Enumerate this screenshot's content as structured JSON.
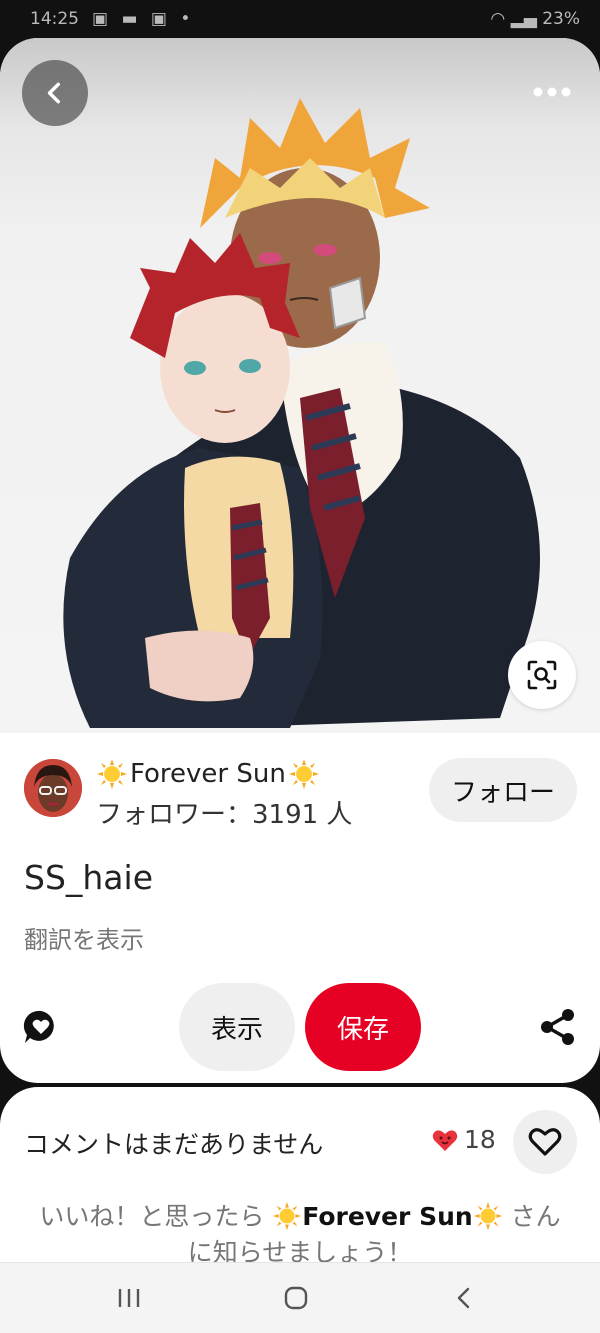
{
  "status": {
    "time": "14:25",
    "battery": "23%"
  },
  "pin": {
    "title": "SS_haie",
    "translate": "翻訳を表示"
  },
  "creator": {
    "name": "Forever Sun",
    "followers": "フォロワー：3191 人",
    "follow_label": "フォロー"
  },
  "actions": {
    "view_label": "表示",
    "save_label": "保存"
  },
  "comments": {
    "empty_text": "コメントはまだありません",
    "like_count": "18",
    "prompt_before": "いいね！と思ったら ",
    "prompt_name": "Forever Sun",
    "prompt_after": " さんに知らせましょう！"
  },
  "colors": {
    "save_red": "#e60023",
    "heart_red": "#e8333c",
    "pill_gray": "#efefef"
  },
  "icons": [
    "back-icon",
    "more-icon",
    "visual-search-icon",
    "comment-heart-icon",
    "share-icon",
    "heart-outline-icon",
    "sun-emoji-icon"
  ]
}
